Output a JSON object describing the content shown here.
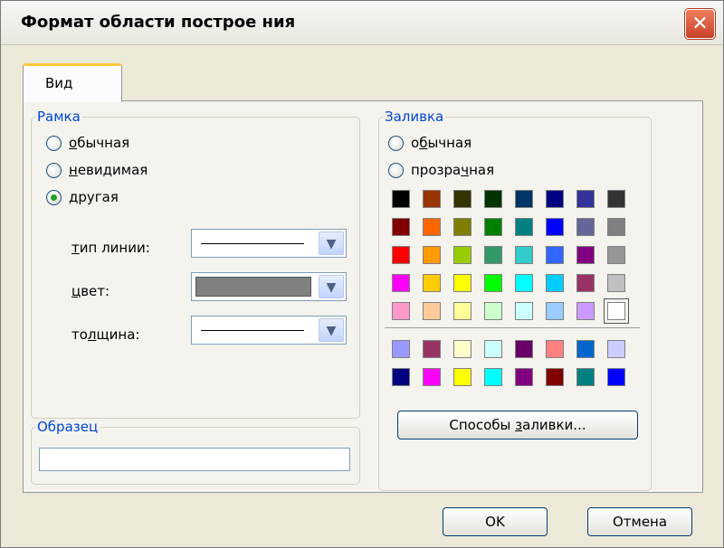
{
  "window": {
    "title": "Формат области построе ния",
    "close_glyph": "✕"
  },
  "tabs": [
    {
      "label": "Вид"
    }
  ],
  "frame": {
    "title": "Рамка",
    "options": [
      {
        "pre": "",
        "ul": "о",
        "post": "бычная",
        "checked": false
      },
      {
        "pre": "",
        "ul": "н",
        "post": "евидимая",
        "checked": false
      },
      {
        "pre": "",
        "ul": "д",
        "post": "ругая",
        "checked": true
      }
    ],
    "line_type_pre": "",
    "line_type_ul": "т",
    "line_type_post": "ип линии:",
    "color_pre": "",
    "color_ul": "ц",
    "color_post": "вет:",
    "thickness_pre": "то",
    "thickness_ul": "л",
    "thickness_post": "щина:",
    "color_value": "#808080"
  },
  "sample": {
    "title": "Образец"
  },
  "fill": {
    "title": "Заливка",
    "options": [
      {
        "pre": "о",
        "ul": "б",
        "post": "ычная",
        "checked": false
      },
      {
        "pre": "прозра",
        "ul": "ч",
        "post": "ная",
        "checked": false
      }
    ],
    "palette_top": [
      [
        "#000000",
        "#993300",
        "#333300",
        "#003300",
        "#003366",
        "#000080",
        "#333399",
        "#333333"
      ],
      [
        "#800000",
        "#ff6600",
        "#808000",
        "#008000",
        "#008080",
        "#0000ff",
        "#666699",
        "#808080"
      ],
      [
        "#ff0000",
        "#ff9900",
        "#99cc00",
        "#339966",
        "#33cccc",
        "#3366ff",
        "#800080",
        "#969696"
      ],
      [
        "#ff00ff",
        "#ffcc00",
        "#ffff00",
        "#00ff00",
        "#00ffff",
        "#00ccff",
        "#993366",
        "#c0c0c0"
      ],
      [
        "#ff99cc",
        "#ffcc99",
        "#ffff99",
        "#ccffcc",
        "#ccffff",
        "#99ccff",
        "#cc99ff",
        "#ffffff"
      ]
    ],
    "palette_bottom": [
      [
        "#9999ff",
        "#993366",
        "#ffffcc",
        "#ccffff",
        "#660066",
        "#ff8080",
        "#0066cc",
        "#ccccff"
      ],
      [
        "#000080",
        "#ff00ff",
        "#ffff00",
        "#00ffff",
        "#800080",
        "#800000",
        "#008080",
        "#0000ff"
      ]
    ],
    "fill_effects_pre": "Способы ",
    "fill_effects_ul": "з",
    "fill_effects_post": "аливки..."
  },
  "buttons": {
    "ok": "OK",
    "cancel": "Отмена"
  }
}
